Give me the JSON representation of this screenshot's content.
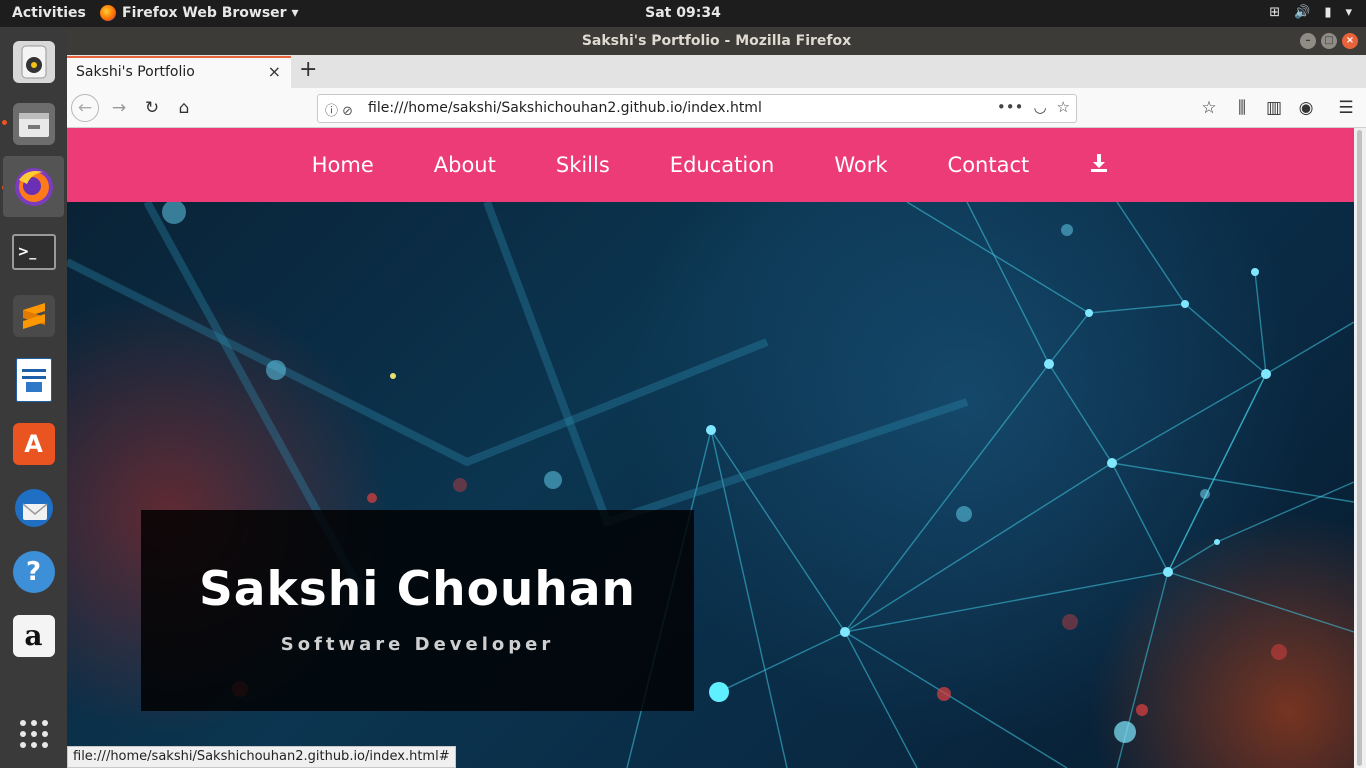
{
  "topbar": {
    "activities": "Activities",
    "app_name": "Firefox Web Browser ▾",
    "clock": "Sat 09:34"
  },
  "window": {
    "title": "Sakshi's Portfolio - Mozilla Firefox"
  },
  "tab": {
    "title": "Sakshi's Portfolio",
    "close": "×",
    "new_tab": "+"
  },
  "urlbar": {
    "url": "file:///home/sakshi/Sakshichouhan2.github.io/index.html"
  },
  "site": {
    "nav": [
      "Home",
      "About",
      "Skills",
      "Education",
      "Work",
      "Contact"
    ],
    "accent_color": "#ec3b76",
    "name": "Sakshi Chouhan",
    "role": "Software Developer"
  },
  "statusbar": {
    "text": "file:///home/sakshi/Sakshichouhan2.github.io/index.html#"
  },
  "dock": {
    "icons": [
      "rhythmbox-icon",
      "files-icon",
      "firefox-icon",
      "terminal-icon",
      "sublime-text-icon",
      "libreoffice-writer-icon",
      "software-center-icon",
      "thunderbird-icon",
      "help-icon",
      "amazon-icon",
      "app-grid-icon"
    ]
  }
}
